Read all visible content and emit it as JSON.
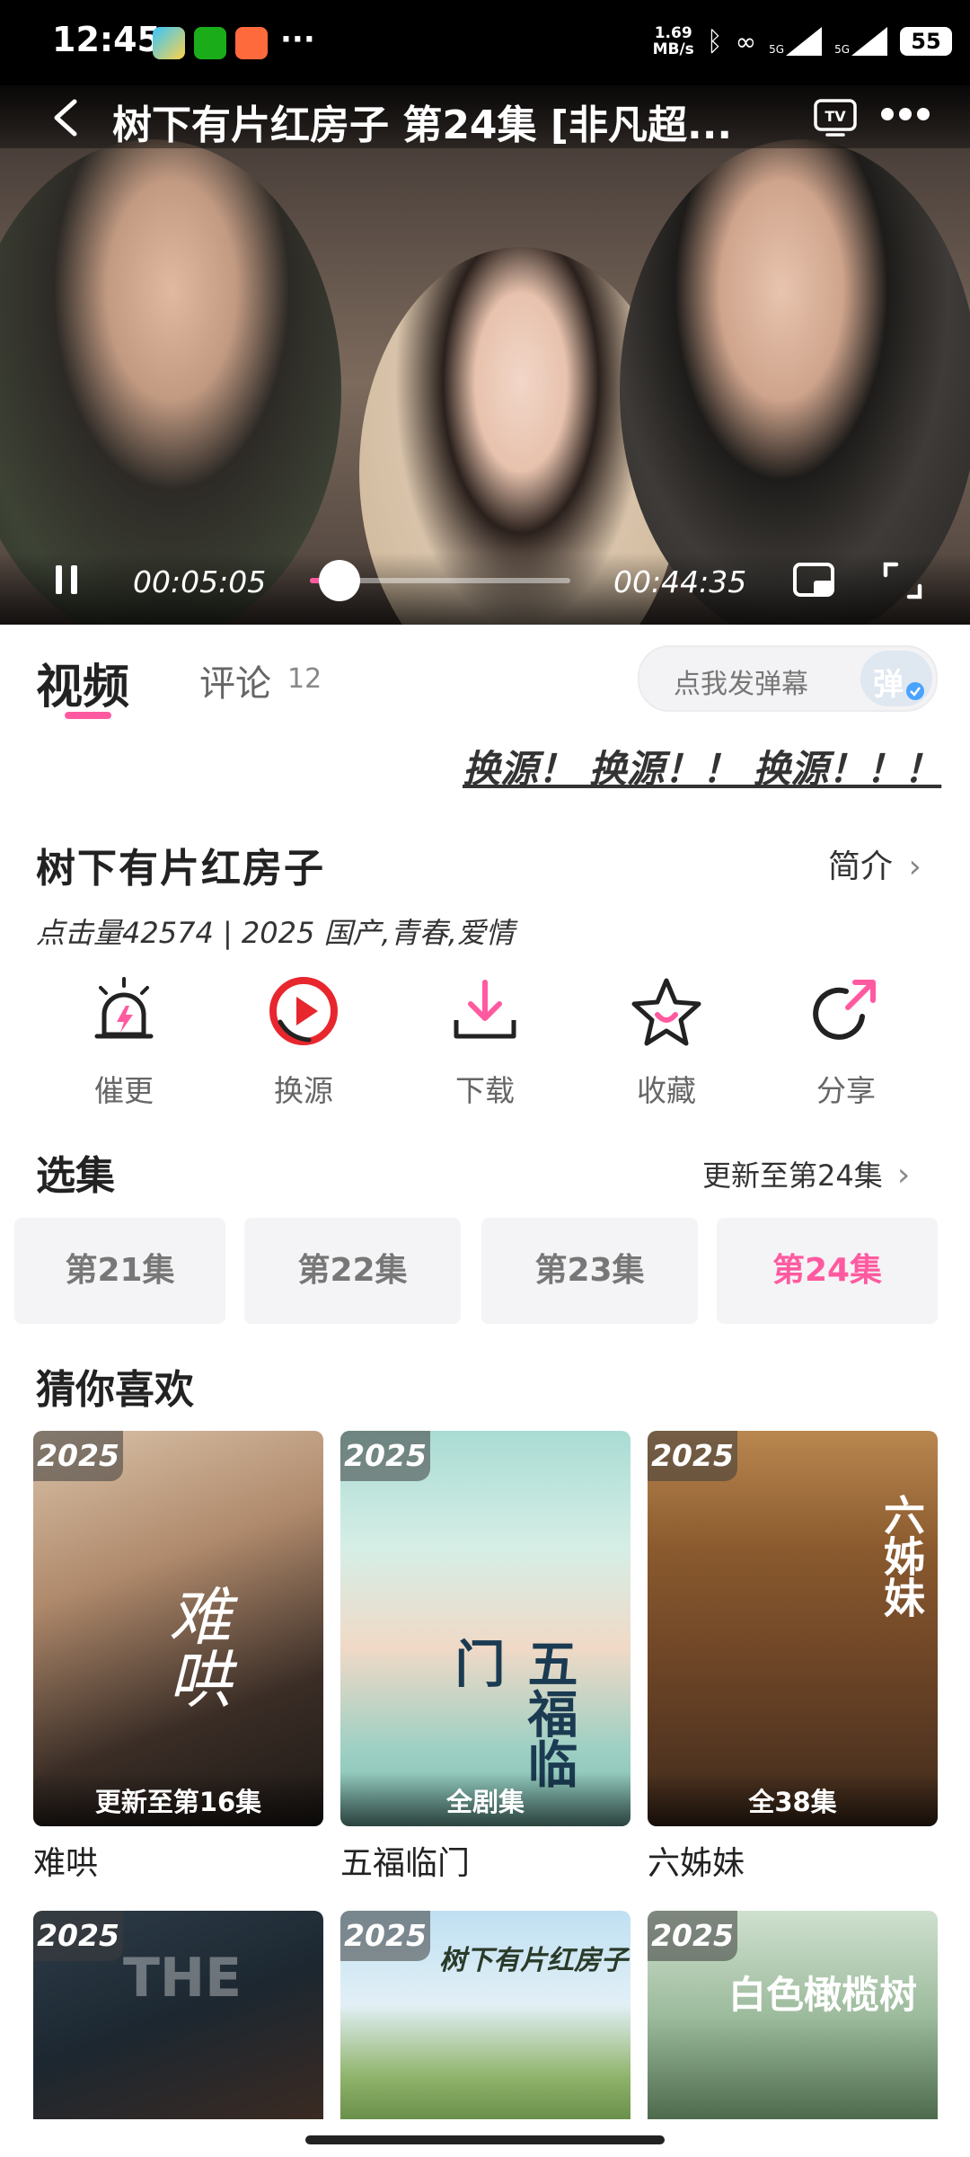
{
  "status_bar": {
    "time": "12:45",
    "net_speed_top": "1.69",
    "net_speed_bottom": "MB/s",
    "signal1": "5G",
    "signal2": "5G",
    "battery": "55",
    "more": "···"
  },
  "player": {
    "title": "树下有片红房子 第24集 [非凡超...",
    "current_time": "00:05:05",
    "total_time": "00:44:35",
    "progress": 0.114
  },
  "tabs": {
    "video": "视频",
    "comments": "评论",
    "comments_count": "12"
  },
  "danmu": {
    "placeholder": "点我发弹幕",
    "toggle": "弹"
  },
  "marquee": "换源！ 换源！！ 换源！！！",
  "show": {
    "title": "树下有片红房子",
    "intro": "简介",
    "meta": "点击量42574 | 2025 国产,青春,爱情"
  },
  "actions": [
    {
      "label": "催更",
      "icon": "alarm-icon"
    },
    {
      "label": "换源",
      "icon": "switch-source-icon"
    },
    {
      "label": "下载",
      "icon": "download-icon"
    },
    {
      "label": "收藏",
      "icon": "star-icon"
    },
    {
      "label": "分享",
      "icon": "share-icon"
    }
  ],
  "episodes": {
    "section_title": "选集",
    "update_text": "更新至第24集",
    "items": [
      "第21集",
      "第22集",
      "第23集",
      "第24集"
    ],
    "active_index": 3
  },
  "recommend": {
    "section_title": "猜你喜欢",
    "items": [
      {
        "year": "2025",
        "status": "更新至第16集",
        "title": "难哄",
        "poster_text": "难哄"
      },
      {
        "year": "2025",
        "status": "全剧集",
        "title": "五福临门",
        "poster_text": "五福临门"
      },
      {
        "year": "2025",
        "status": "全38集",
        "title": "六姊妹",
        "poster_text": "六姊妹"
      },
      {
        "year": "2025",
        "status": "",
        "title": "",
        "poster_text": "THE"
      },
      {
        "year": "2025",
        "status": "",
        "title": "",
        "poster_text": "树下有片红房子"
      },
      {
        "year": "2025",
        "status": "",
        "title": "",
        "poster_text": "白色橄榄树"
      }
    ]
  },
  "colors": {
    "accent": "#ff5aa0",
    "status_bar": "#000000"
  }
}
